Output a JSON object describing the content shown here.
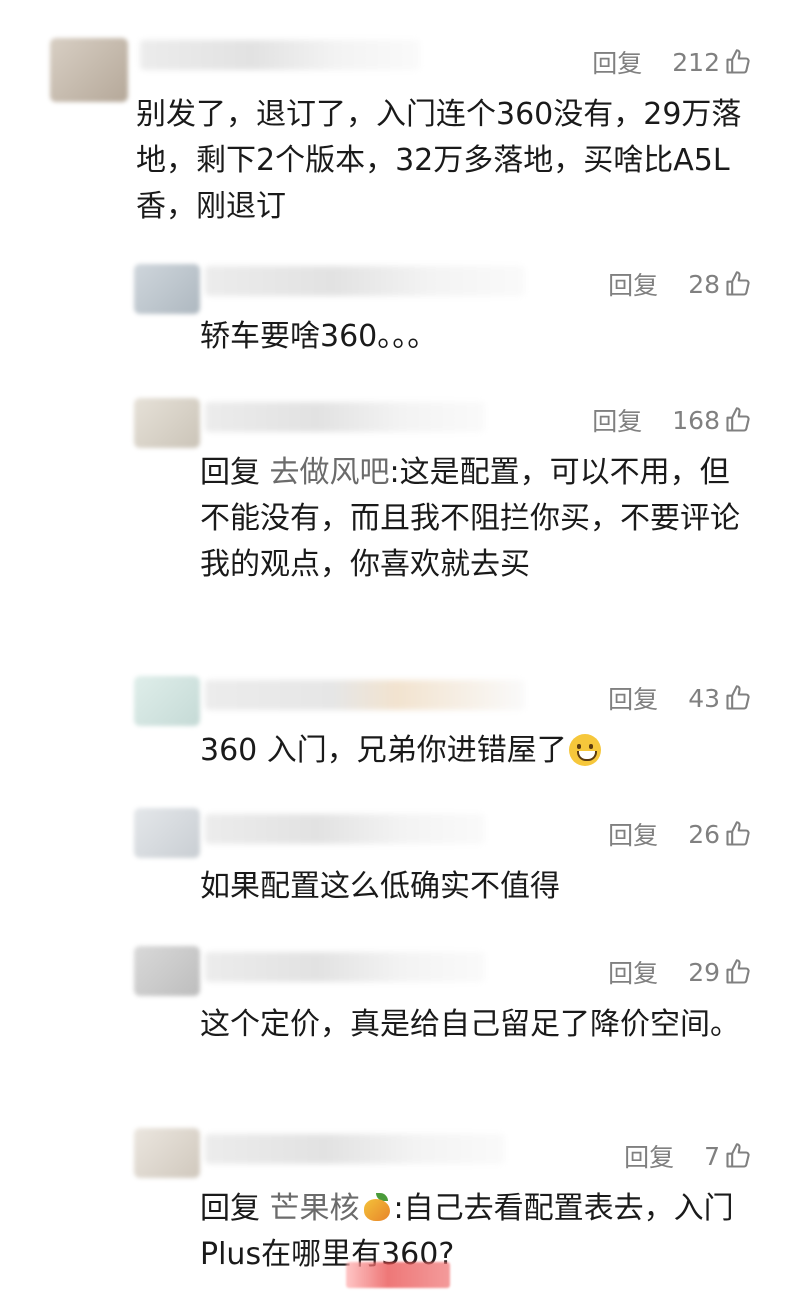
{
  "comments": [
    {
      "reply_label": "回复",
      "likes": "212",
      "text": "别发了，退订了，入门连个360没有，29万落地，剩下2个版本，32万多落地，买啥比A5L香，刚退订"
    },
    {
      "reply_label": "回复",
      "likes": "28",
      "text": "轿车要啥360。。。"
    },
    {
      "reply_label": "回复",
      "likes": "168",
      "reply_prefix": "回复",
      "reply_target": "去做风吧",
      "text": ":这是配置，可以不用，但不能没有，而且我不阻拦你买，不要评论我的观点，你喜欢就去买"
    },
    {
      "reply_label": "回复",
      "likes": "43",
      "text": "360 入门，兄弟你进错屋了",
      "emoji": "grinning-face-emoji"
    },
    {
      "reply_label": "回复",
      "likes": "26",
      "text": "如果配置这么低确实不值得"
    },
    {
      "reply_label": "回复",
      "likes": "29",
      "text": "这个定价，真是给自己留足了降价空间。"
    },
    {
      "reply_label": "回复",
      "likes": "7",
      "reply_prefix": "回复",
      "reply_target": "芒果核",
      "text": ":自己去看配置表去，入门Plus在哪里有360?",
      "emoji": "mango-emoji"
    }
  ],
  "icons": {
    "like": "thumbs-up-icon"
  },
  "colors": {
    "meta": "#808080",
    "text": "#1a1a1a",
    "reply_target": "#6b6b6b"
  }
}
